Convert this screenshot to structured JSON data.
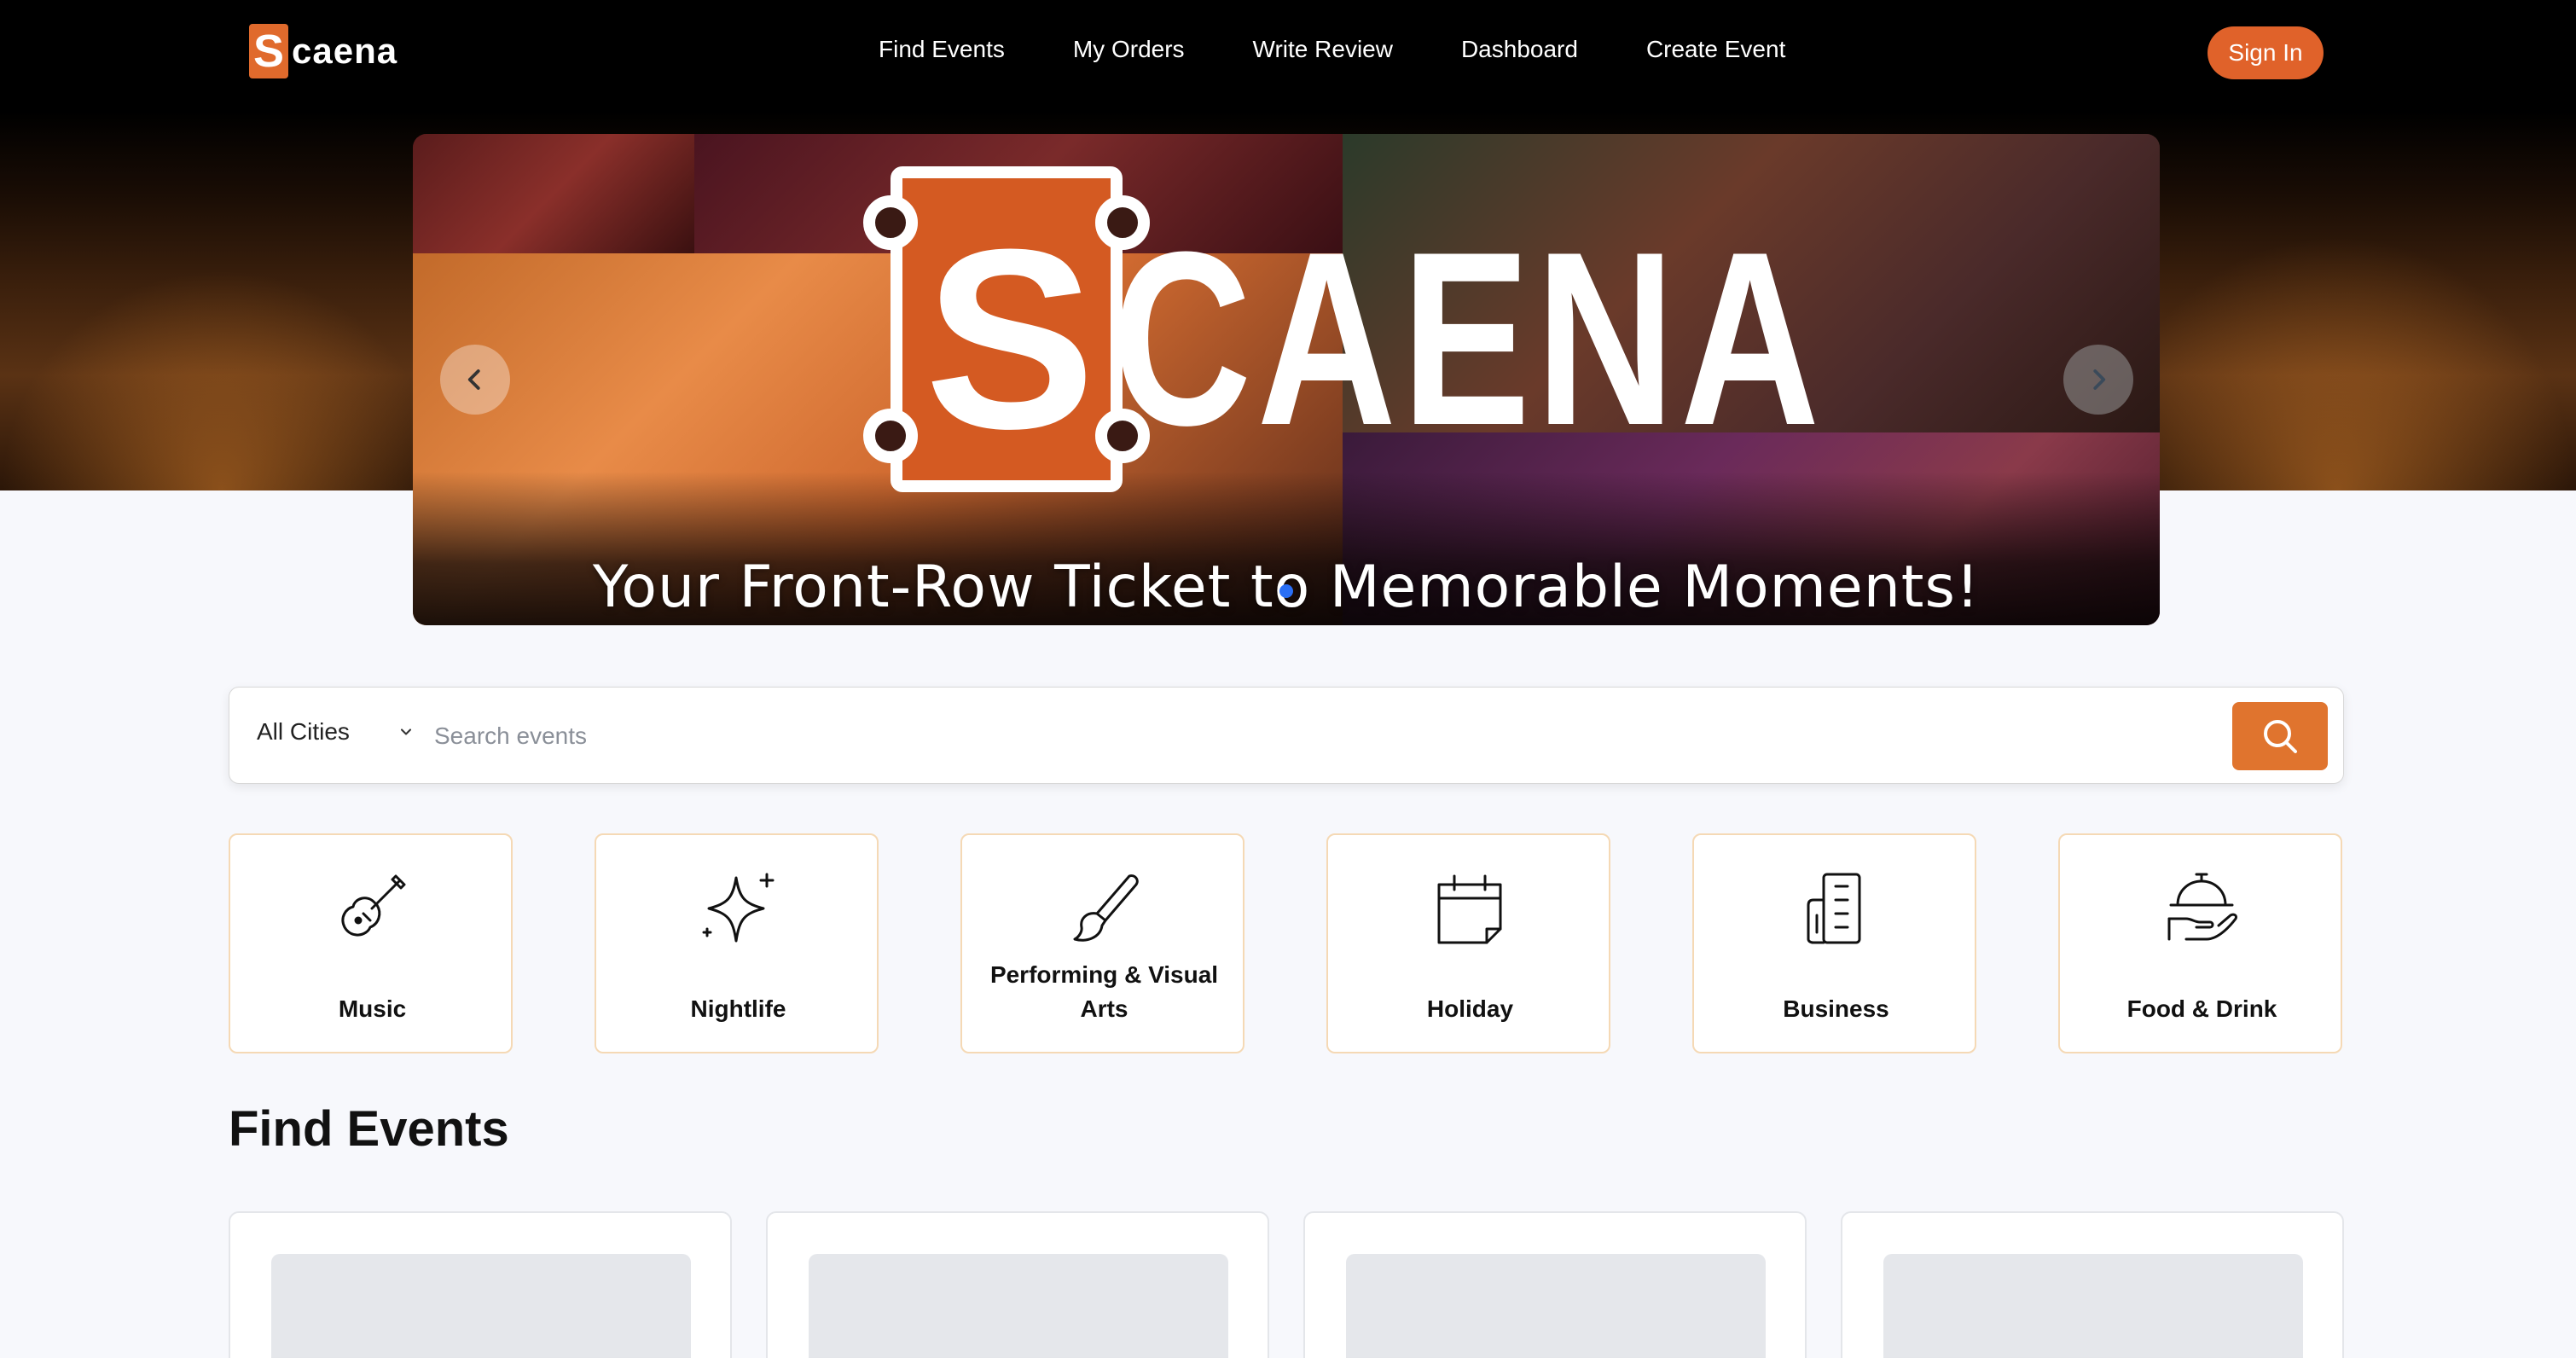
{
  "nav": {
    "logo_letter": "S",
    "logo_text": "caena",
    "links": [
      "Find Events",
      "My Orders",
      "Write Review",
      "Dashboard",
      "Create Event"
    ],
    "signin_label": "Sign In"
  },
  "hero": {
    "brand_letter": "S",
    "brand_word": "CAENA",
    "tagline": "Your Front-Row Ticket to Memorable Moments!",
    "prev_icon": "chevron-left-icon",
    "next_icon": "chevron-right-icon"
  },
  "search": {
    "city_value": "All Cities",
    "placeholder": "Search events",
    "button_icon": "search-icon"
  },
  "categories": [
    {
      "label": "Music",
      "icon": "guitar-icon"
    },
    {
      "label": "Nightlife",
      "icon": "sparkle-icon"
    },
    {
      "label": "Performing & Visual Arts",
      "icon": "paintbrush-icon"
    },
    {
      "label": "Holiday",
      "icon": "calendar-icon"
    },
    {
      "label": "Business",
      "icon": "building-icon"
    },
    {
      "label": "Food & Drink",
      "icon": "serving-dish-icon"
    }
  ],
  "section": {
    "title": "Find Events"
  },
  "colors": {
    "accent": "#E0622A",
    "card_border": "#F5D9B5",
    "carousel_dot": "#2A6FF5"
  }
}
